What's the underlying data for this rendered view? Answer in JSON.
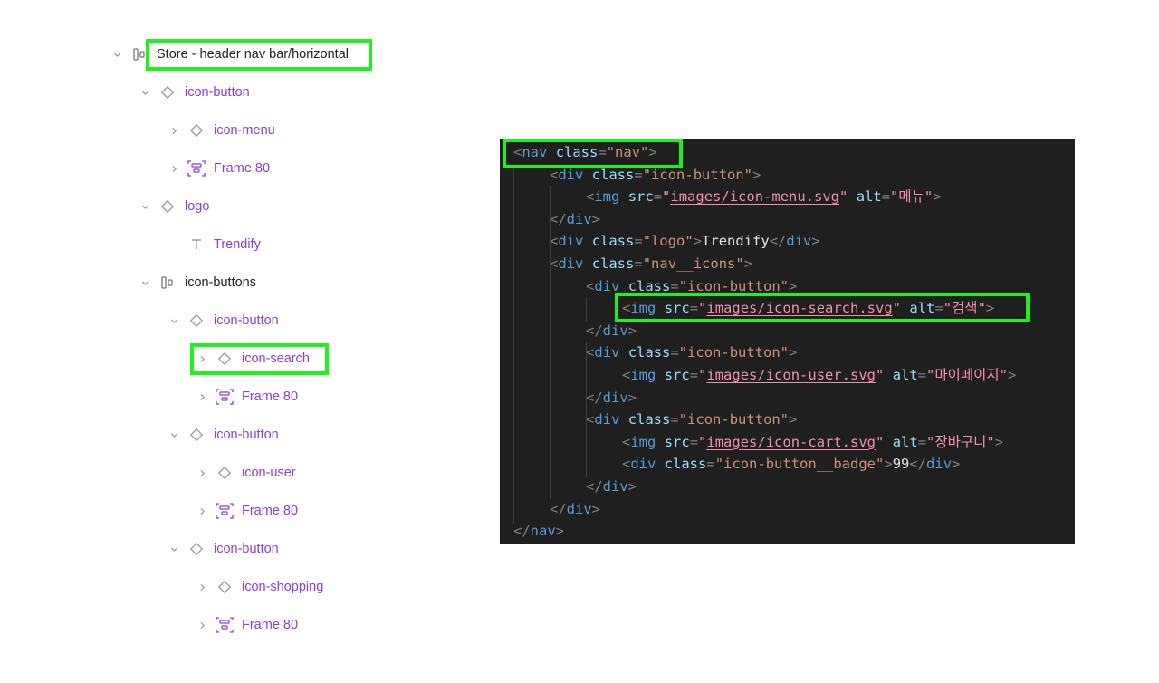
{
  "layers": {
    "rows": [
      {
        "label": "Store - header nav bar/horizontal",
        "icon": "autolayout-icon",
        "chevron": "down",
        "dark": true
      },
      {
        "label": "icon-button",
        "icon": "component-instance-icon",
        "chevron": "down"
      },
      {
        "label": "icon-menu",
        "icon": "component-instance-icon",
        "chevron": "right"
      },
      {
        "label": "Frame 80",
        "icon": "frame-autolayout-icon",
        "chevron": "right"
      },
      {
        "label": "logo",
        "icon": "component-instance-icon",
        "chevron": "down"
      },
      {
        "label": "Trendify",
        "icon": "text-icon",
        "chevron": "none"
      },
      {
        "label": "icon-buttons",
        "icon": "autolayout-icon",
        "chevron": "down",
        "dark": true
      },
      {
        "label": "icon-button",
        "icon": "component-instance-icon",
        "chevron": "down"
      },
      {
        "label": "icon-search",
        "icon": "component-instance-icon",
        "chevron": "right"
      },
      {
        "label": "Frame 80",
        "icon": "frame-autolayout-icon",
        "chevron": "right"
      },
      {
        "label": "icon-button",
        "icon": "component-instance-icon",
        "chevron": "down"
      },
      {
        "label": "icon-user",
        "icon": "component-instance-icon",
        "chevron": "right"
      },
      {
        "label": "Frame 80",
        "icon": "frame-autolayout-icon",
        "chevron": "right"
      },
      {
        "label": "icon-button",
        "icon": "component-instance-icon",
        "chevron": "down"
      },
      {
        "label": "icon-shopping",
        "icon": "component-instance-icon",
        "chevron": "right"
      },
      {
        "label": "Frame 80",
        "icon": "frame-autolayout-icon",
        "chevron": "right"
      }
    ]
  },
  "code": {
    "lines": [
      [
        [
          "br",
          "<"
        ],
        [
          "tag",
          "nav"
        ],
        [
          "sp",
          " "
        ],
        [
          "attr",
          "class"
        ],
        [
          "br",
          "="
        ],
        [
          "str",
          "\"nav\""
        ],
        [
          "br",
          ">"
        ]
      ],
      [
        [
          "br",
          "<"
        ],
        [
          "tag",
          "div"
        ],
        [
          "sp",
          " "
        ],
        [
          "attr",
          "class"
        ],
        [
          "br",
          "="
        ],
        [
          "str",
          "\"icon-button\""
        ],
        [
          "br",
          ">"
        ]
      ],
      [
        [
          "br",
          "<"
        ],
        [
          "tag",
          "img"
        ],
        [
          "sp",
          " "
        ],
        [
          "attr",
          "src"
        ],
        [
          "br",
          "="
        ],
        [
          "pink",
          "\""
        ],
        [
          "link",
          "images/icon-menu.svg"
        ],
        [
          "pink",
          "\""
        ],
        [
          "sp",
          " "
        ],
        [
          "attr",
          "alt"
        ],
        [
          "br",
          "="
        ],
        [
          "pink",
          "\"메뉴\""
        ],
        [
          "br",
          ">"
        ]
      ],
      [
        [
          "br",
          "</"
        ],
        [
          "tag",
          "div"
        ],
        [
          "br",
          ">"
        ]
      ],
      [
        [
          "br",
          "<"
        ],
        [
          "tag",
          "div"
        ],
        [
          "sp",
          " "
        ],
        [
          "attr",
          "class"
        ],
        [
          "br",
          "="
        ],
        [
          "str",
          "\"logo\""
        ],
        [
          "br",
          ">"
        ],
        [
          "txt",
          "Trendify"
        ],
        [
          "br",
          "</"
        ],
        [
          "tag",
          "div"
        ],
        [
          "br",
          ">"
        ]
      ],
      [
        [
          "br",
          "<"
        ],
        [
          "tag",
          "div"
        ],
        [
          "sp",
          " "
        ],
        [
          "attr",
          "class"
        ],
        [
          "br",
          "="
        ],
        [
          "str",
          "\"nav__icons\""
        ],
        [
          "br",
          ">"
        ]
      ],
      [
        [
          "br",
          "<"
        ],
        [
          "tag",
          "div"
        ],
        [
          "sp",
          " "
        ],
        [
          "attr",
          "class"
        ],
        [
          "br",
          "="
        ],
        [
          "str",
          "\"icon-button\""
        ],
        [
          "br",
          ">"
        ]
      ],
      [
        [
          "br",
          "<"
        ],
        [
          "tag",
          "img"
        ],
        [
          "sp",
          " "
        ],
        [
          "attr",
          "src"
        ],
        [
          "br",
          "="
        ],
        [
          "pink",
          "\""
        ],
        [
          "link",
          "images/icon-search.svg"
        ],
        [
          "pink",
          "\""
        ],
        [
          "sp",
          " "
        ],
        [
          "attr",
          "alt"
        ],
        [
          "br",
          "="
        ],
        [
          "pink",
          "\"검색\""
        ],
        [
          "br",
          ">"
        ]
      ],
      [
        [
          "br",
          "</"
        ],
        [
          "tag",
          "div"
        ],
        [
          "br",
          ">"
        ]
      ],
      [
        [
          "br",
          "<"
        ],
        [
          "tag",
          "div"
        ],
        [
          "sp",
          " "
        ],
        [
          "attr",
          "class"
        ],
        [
          "br",
          "="
        ],
        [
          "str",
          "\"icon-button\""
        ],
        [
          "br",
          ">"
        ]
      ],
      [
        [
          "br",
          "<"
        ],
        [
          "tag",
          "img"
        ],
        [
          "sp",
          " "
        ],
        [
          "attr",
          "src"
        ],
        [
          "br",
          "="
        ],
        [
          "pink",
          "\""
        ],
        [
          "link",
          "images/icon-user.svg"
        ],
        [
          "pink",
          "\""
        ],
        [
          "sp",
          " "
        ],
        [
          "attr",
          "alt"
        ],
        [
          "br",
          "="
        ],
        [
          "pink",
          "\"마이페이지\""
        ],
        [
          "br",
          ">"
        ]
      ],
      [
        [
          "br",
          "</"
        ],
        [
          "tag",
          "div"
        ],
        [
          "br",
          ">"
        ]
      ],
      [
        [
          "br",
          "<"
        ],
        [
          "tag",
          "div"
        ],
        [
          "sp",
          " "
        ],
        [
          "attr",
          "class"
        ],
        [
          "br",
          "="
        ],
        [
          "str",
          "\"icon-button\""
        ],
        [
          "br",
          ">"
        ]
      ],
      [
        [
          "br",
          "<"
        ],
        [
          "tag",
          "img"
        ],
        [
          "sp",
          " "
        ],
        [
          "attr",
          "src"
        ],
        [
          "br",
          "="
        ],
        [
          "pink",
          "\""
        ],
        [
          "link",
          "images/icon-cart.svg"
        ],
        [
          "pink",
          "\""
        ],
        [
          "sp",
          " "
        ],
        [
          "attr",
          "alt"
        ],
        [
          "br",
          "="
        ],
        [
          "pink",
          "\"장바구니\""
        ],
        [
          "br",
          ">"
        ]
      ],
      [
        [
          "br",
          "<"
        ],
        [
          "tag",
          "div"
        ],
        [
          "sp",
          " "
        ],
        [
          "attr",
          "class"
        ],
        [
          "br",
          "="
        ],
        [
          "str",
          "\"icon-button__badge\""
        ],
        [
          "br",
          ">"
        ],
        [
          "txt",
          "99"
        ],
        [
          "br",
          "</"
        ],
        [
          "tag",
          "div"
        ],
        [
          "br",
          ">"
        ]
      ],
      [
        [
          "br",
          "</"
        ],
        [
          "tag",
          "div"
        ],
        [
          "br",
          ">"
        ]
      ],
      [
        [
          "br",
          "</"
        ],
        [
          "tag",
          "div"
        ],
        [
          "br",
          ">"
        ]
      ],
      [
        [
          "br",
          "</"
        ],
        [
          "tag",
          "nav"
        ],
        [
          "br",
          ">"
        ]
      ]
    ]
  },
  "highlight_color": "#1df21a"
}
